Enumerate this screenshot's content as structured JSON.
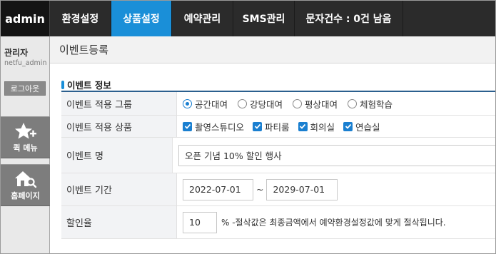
{
  "topnav": {
    "logo": "admin",
    "tabs": [
      {
        "label": "환경설정",
        "active": false
      },
      {
        "label": "상품설정",
        "active": true
      },
      {
        "label": "예약관리",
        "active": false
      },
      {
        "label": "SMS관리",
        "active": false
      },
      {
        "label": "문자건수 : 0건 남음",
        "active": false
      }
    ]
  },
  "sidebar": {
    "role": "관리자",
    "user_id": "netfu_admin",
    "logout_label": "로그아웃",
    "quick_menu_label": "퀵 메뉴",
    "homepage_label": "홈페이지"
  },
  "main": {
    "page_title": "이벤트등록",
    "section_title": "이벤트 정보",
    "group": {
      "label": "이벤트 적용 그룹",
      "options": [
        "공간대여",
        "강당대여",
        "평상대여",
        "체험학습"
      ],
      "selected": "공간대여"
    },
    "products": {
      "label": "이벤트 적용 상품",
      "options": [
        "촬영스튜디오",
        "파티룸",
        "회의실",
        "연습실"
      ],
      "checked": [
        true,
        true,
        true,
        true
      ]
    },
    "name": {
      "label": "이벤트 명",
      "value": "오픈 기념 10% 할인 행사"
    },
    "period": {
      "label": "이벤트 기간",
      "start": "2022-07-01",
      "separator": "~",
      "end": "2029-07-01"
    },
    "discount": {
      "label": "할인율",
      "value": "10",
      "note": "% -절삭값은 최종금액에서 예약환경설정값에 맞게 절삭됩니다."
    }
  },
  "colors": {
    "accent": "#1a8fd8",
    "nav_bg": "#2b2b2b",
    "sidebar_button": "#7d7d7d"
  }
}
